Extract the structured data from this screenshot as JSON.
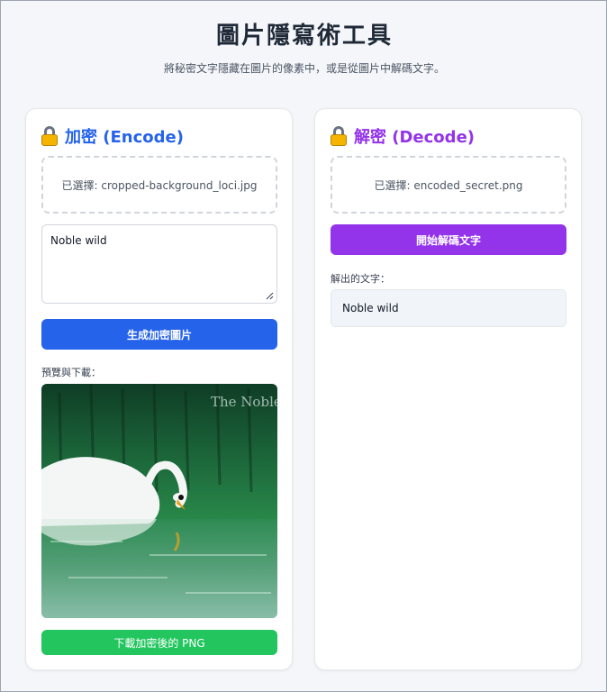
{
  "header": {
    "title": "圖片隱寫術工具",
    "subtitle": "將秘密文字隱藏在圖片的像素中，或是從圖片中解碼文字。"
  },
  "encode": {
    "title": "加密 (Encode)",
    "file_selected": "已選擇: cropped-background_loci.jpg",
    "message_value": "Noble wild",
    "generate_button": "生成加密圖片",
    "preview_label": "預覽與下載：",
    "preview_watermark": "The Noble",
    "download_button": "下載加密後的 PNG"
  },
  "decode": {
    "title": "解密 (Decode)",
    "file_selected": "已選擇: encoded_secret.png",
    "decode_button": "開始解碼文字",
    "result_label": "解出的文字：",
    "result_value": "Noble wild"
  },
  "colors": {
    "encode_accent": "#2563eb",
    "decode_accent": "#9333ea",
    "download_green": "#22c55e"
  },
  "icons": {
    "encode_icon": "lock-icon",
    "decode_icon": "lock-icon"
  }
}
